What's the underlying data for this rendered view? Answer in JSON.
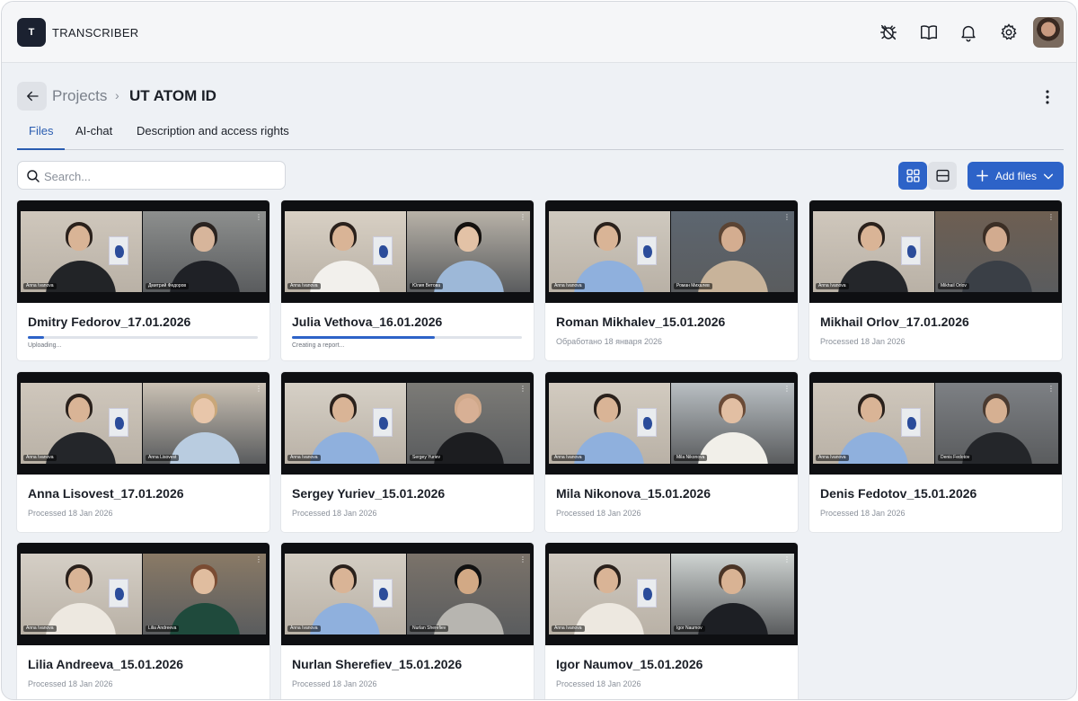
{
  "app": {
    "logo_letter": "T",
    "name": "TRANSCRIBER"
  },
  "topbar": {
    "icons": [
      "bug-icon",
      "book-icon",
      "bell-icon",
      "gear-icon"
    ],
    "avatar": "user-avatar"
  },
  "header": {
    "breadcrumb_parent": "Projects",
    "breadcrumb_separator": "›",
    "title": "UT ATOM ID"
  },
  "tabs": [
    {
      "label": "Files",
      "active": true
    },
    {
      "label": "AI-chat",
      "active": false
    },
    {
      "label": "Description and access rights",
      "active": false
    }
  ],
  "search": {
    "placeholder": "Search..."
  },
  "toolbar": {
    "add_label": "Add files",
    "view_mode": "grid"
  },
  "colors": {
    "accent": "#2d63c8",
    "dark": "#1b2130",
    "background": "#eef1f5"
  },
  "files": [
    {
      "title": "Dmitry Fedorov_17.01.2026",
      "status": "Uploading...",
      "progress": 0.07,
      "left_name": "Anna Ivanova",
      "right_name": "Дмитрий Федоров"
    },
    {
      "title": "Julia Vethova_16.01.2026",
      "status": "Creating a report...",
      "progress": 0.62,
      "left_name": "Anna Ivanova",
      "right_name": "Юлия Ветова"
    },
    {
      "title": "Roman Mikhalev_15.01.2026",
      "status": "Обработано 18 января 2026",
      "left_name": "Anna Ivanova",
      "right_name": "Роман Михалев"
    },
    {
      "title": "Mikhail Orlov_17.01.2026",
      "status": "Processed 18 Jan 2026",
      "left_name": "Anna Ivanova",
      "right_name": "Mikhail Orlov"
    },
    {
      "title": "Anna Lisovest_17.01.2026",
      "status": "Processed 18 Jan 2026",
      "left_name": "Anna Ivanova",
      "right_name": "Anna Lisovest"
    },
    {
      "title": "Sergey Yuriev_15.01.2026",
      "status": "Processed 18 Jan 2026",
      "left_name": "Anna Ivanova",
      "right_name": "Sergey Yuriev"
    },
    {
      "title": "Mila Nikonova_15.01.2026",
      "status": "Processed 18 Jan 2026",
      "left_name": "Anna Ivanova",
      "right_name": "Mila Nikonova"
    },
    {
      "title": "Denis Fedotov_15.01.2026",
      "status": "Processed 18 Jan 2026",
      "left_name": "Anna Ivanova",
      "right_name": "Denis Fedotov"
    },
    {
      "title": "Lilia Andreeva_15.01.2026",
      "status": "Processed 18 Jan 2026",
      "left_name": "Anna Ivanova",
      "right_name": "Lilia Andreeva"
    },
    {
      "title": "Nurlan Sherefiev_15.01.2026",
      "status": "Processed 18 Jan 2026",
      "left_name": "Anna Ivanova",
      "right_name": "Nurlan Sherefiev"
    },
    {
      "title": "Igor Naumov_15.01.2026",
      "status": "Processed 18 Jan 2026",
      "left_name": "Anna Ivanova",
      "right_name": "Igor Naumov"
    }
  ]
}
